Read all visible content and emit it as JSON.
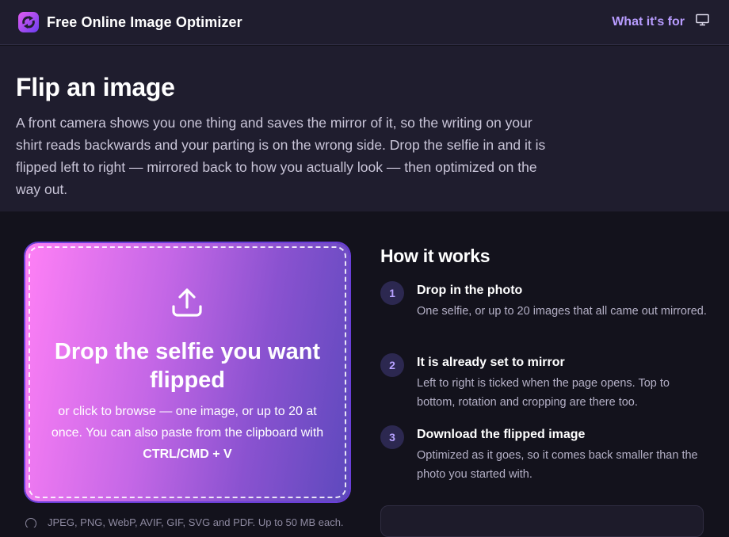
{
  "header": {
    "brand": "Free Online Image Optimizer",
    "nav_link": "What it's for",
    "logo_icon": "refresh-arrows-logo-icon",
    "display_icon": "monitor-icon"
  },
  "hero": {
    "title": "Flip an image",
    "description": "A front camera shows you one thing and saves the mirror of it, so the writing on your shirt reads backwards and your parting is on the wrong side. Drop the selfie in and it is flipped left to right — mirrored back to how you actually look — then optimized on the way out."
  },
  "dropzone": {
    "icon": "upload-icon",
    "title": "Drop the selfie you want flipped",
    "subtitle_prefix": "or click to browse — one image, or up to 20 at once. You can also paste from the clipboard with ",
    "shortcut": "CTRL/CMD + V",
    "formats": "JPEG, PNG, WebP, AVIF, GIF, SVG and PDF. Up to 50 MB each."
  },
  "how_it_works": {
    "title": "How it works",
    "steps": [
      {
        "number": "1",
        "title": "Drop in the photo",
        "description": "One selfie, or up to 20 images that all came out mirrored."
      },
      {
        "number": "2",
        "title": "It is already set to mirror",
        "description": "Left to right is ticked when the page opens. Top to bottom, rotation and cropping are there too."
      },
      {
        "number": "3",
        "title": "Download the flipped image",
        "description": "Optimized as it goes, so it comes back smaller than the photo you started with."
      }
    ]
  },
  "colors": {
    "accent": "#b89cff",
    "gradient_start": "#ff80f6",
    "gradient_end": "#5d49bd",
    "page_bg": "#13121c",
    "header_bg": "#1f1d2e"
  }
}
